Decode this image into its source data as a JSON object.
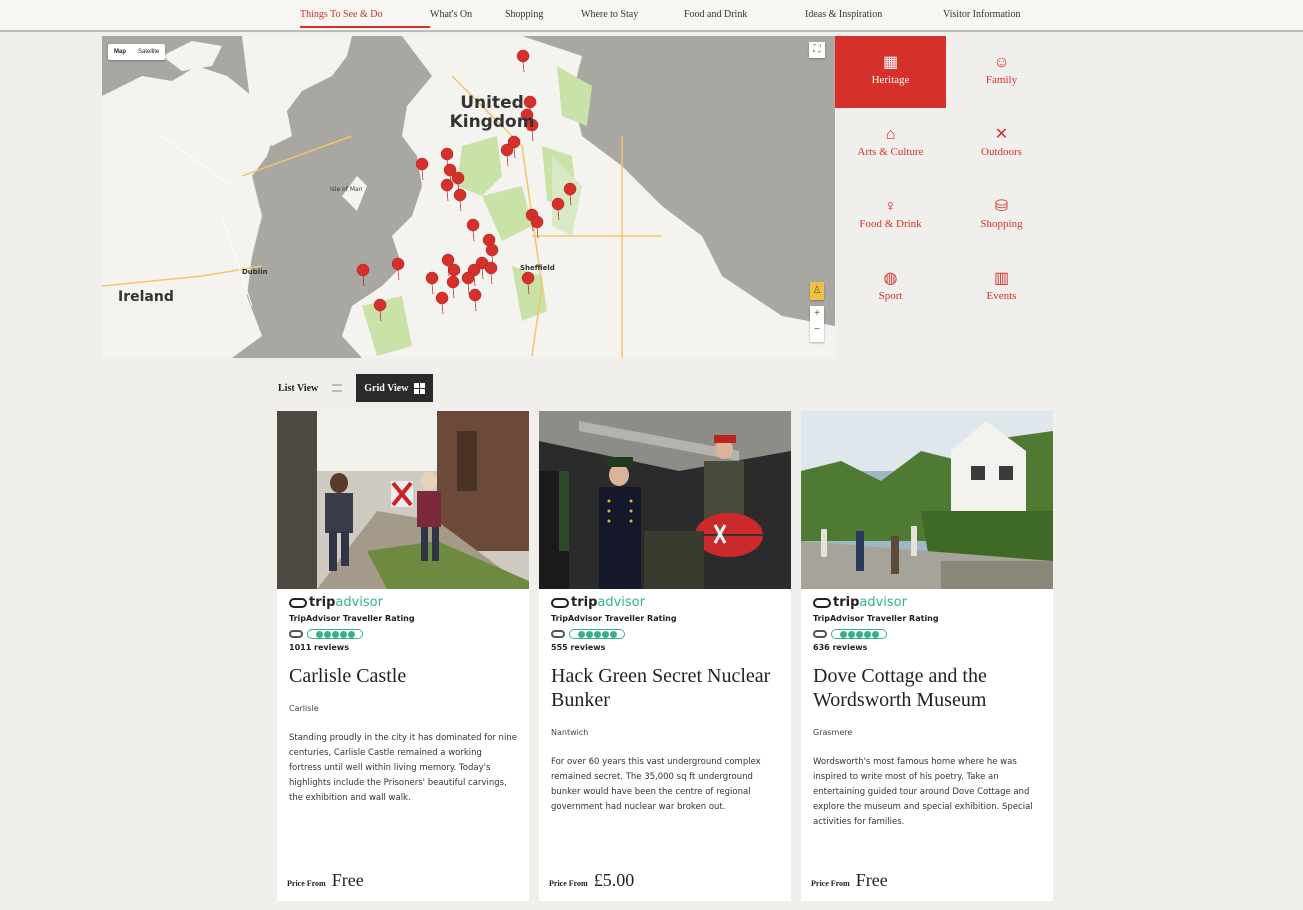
{
  "nav": {
    "items": [
      {
        "label": "Things To See & Do",
        "active": true
      },
      {
        "label": "What's On"
      },
      {
        "label": "Shopping"
      },
      {
        "label": "Where to Stay"
      },
      {
        "label": "Food and Drink"
      },
      {
        "label": "Ideas & Inspiration"
      },
      {
        "label": "Visitor Information"
      }
    ]
  },
  "map": {
    "type_buttons": {
      "map": "Map",
      "satellite": "Satellite"
    },
    "labels": {
      "uk": "United Kingdom",
      "ireland": "Ireland",
      "isle_of_man": "Isle of Man",
      "sheffield": "Sheffield",
      "dublin": "Dublin"
    },
    "zoom_in": "+",
    "zoom_out": "−",
    "accent": "#d6302b"
  },
  "categories": [
    {
      "label": "Heritage",
      "icon": "building-icon",
      "glyph": "▦",
      "active": true
    },
    {
      "label": "Family",
      "icon": "family-icon",
      "glyph": "☺"
    },
    {
      "label": "Arts & Culture",
      "icon": "museum-icon",
      "glyph": "⌂"
    },
    {
      "label": "Outdoors",
      "icon": "outdoors-icon",
      "glyph": "✕"
    },
    {
      "label": "Food & Drink",
      "icon": "glass-icon",
      "glyph": "♀"
    },
    {
      "label": "Shopping",
      "icon": "bag-icon",
      "glyph": "⛁"
    },
    {
      "label": "Sport",
      "icon": "ball-icon",
      "glyph": "◍"
    },
    {
      "label": "Events",
      "icon": "calendar-icon",
      "glyph": "▥"
    }
  ],
  "view": {
    "list": "List View",
    "grid": "Grid View"
  },
  "tripadvisor": {
    "brand_trip": "trip",
    "brand_advisor": "advisor",
    "rating_label": "TripAdvisor Traveller Rating"
  },
  "cards": [
    {
      "title": "Carlisle Castle",
      "reviews": "1011 reviews",
      "location": "Carlisle",
      "description": "Standing proudly in the city it has dominated for nine centuries, Carlisle Castle remained a working fortress until well within living memory. Today's highlights include the Prisoners' beautiful carvings, the exhibition and wall walk.",
      "price_label": "Price From",
      "price": "Free"
    },
    {
      "title": "Hack Green Secret Nuclear Bunker",
      "reviews": "555 reviews",
      "location": "Nantwich",
      "description": "For over 60 years this vast underground complex remained secret. The 35,000 sq ft underground bunker would have been the centre of regional government had nuclear war broken out.",
      "price_label": "Price From",
      "price": "£5.00"
    },
    {
      "title": "Dove Cottage and the Wordsworth Museum",
      "reviews": "636 reviews",
      "location": "Grasmere",
      "description": "Wordsworth's most famous home where he was inspired to write most of his poetry. Take an entertaining guided tour around Dove Cottage and explore the museum and special exhibition. Special activities for families.",
      "price_label": "Price From",
      "price": "Free"
    }
  ]
}
